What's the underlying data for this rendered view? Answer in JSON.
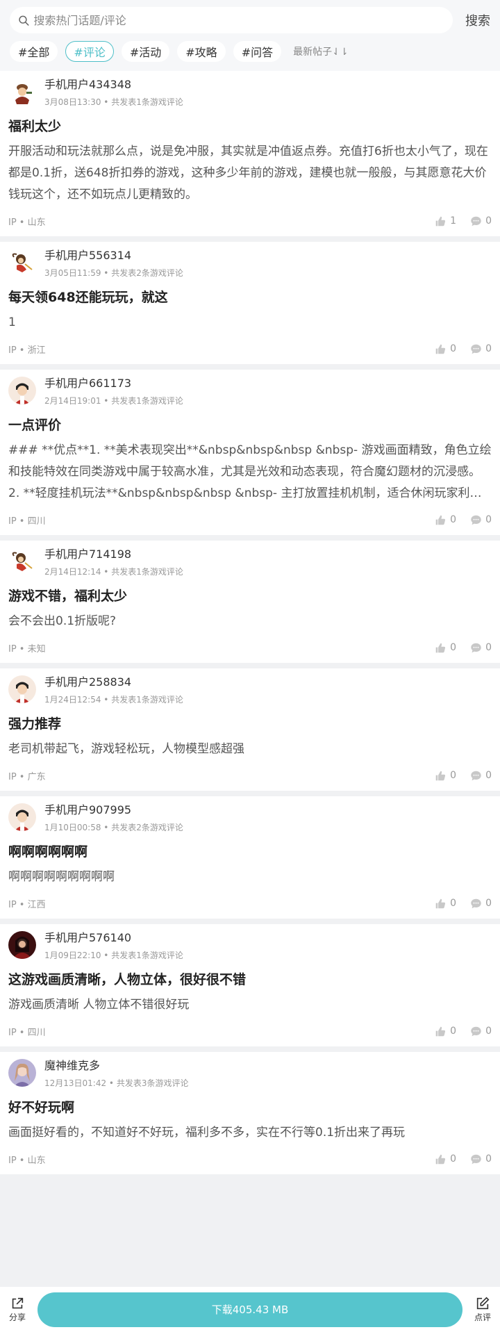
{
  "search": {
    "placeholder": "搜索热门话题/评论",
    "button": "搜索"
  },
  "tags": [
    {
      "label": "#全部",
      "active": false
    },
    {
      "label": "#评论",
      "active": true
    },
    {
      "label": "#活动",
      "active": false
    },
    {
      "label": "#攻略",
      "active": false
    },
    {
      "label": "#问答",
      "active": false
    }
  ],
  "sort_label": "最新帖子⇃⇂",
  "posts": [
    {
      "user": "手机用户434348",
      "meta": "3月08日13:30 • 共发表1条游戏评论",
      "title": "福利太少",
      "body": "开服活动和玩法就那么点，说是免冲服，其实就是冲值返点券。充值打6折也太小气了，现在都是0.1折，送648折扣券的游戏，这种多少年前的游戏，建模也就一般般，与其愿意花大价钱玩这个，还不如玩点儿更精致的。",
      "ip": "IP • 山东",
      "likes": "1",
      "comments": "0",
      "avatar": "warrior"
    },
    {
      "user": "手机用户556314",
      "meta": "3月05日11:59 • 共发表2条游戏评论",
      "title": "每天领648还能玩玩，就这",
      "body": "1",
      "ip": "IP • 浙江",
      "likes": "0",
      "comments": "0",
      "avatar": "monkey"
    },
    {
      "user": "手机用户661173",
      "meta": "2月14日19:01 • 共发表1条游戏评论",
      "title": "一点评价",
      "body": "### **优点**1. **美术表现突出**&nbsp&nbsp&nbsp &nbsp- 游戏画面精致，角色立绘和技能特效在同类游戏中属于较高水准，尤其是光效和动态表现，符合魔幻题材的沉浸感。2. **轻度挂机玩法**&nbsp&nbsp&nbsp &nbsp- 主打放置挂机机制，适合休闲玩家利用碎片时间游玩。",
      "ip": "IP • 四川",
      "likes": "0",
      "comments": "0",
      "avatar": "boy"
    },
    {
      "user": "手机用户714198",
      "meta": "2月14日12:14 • 共发表1条游戏评论",
      "title": "游戏不错，福利太少",
      "body": "会不会出0.1折版呢?",
      "ip": "IP • 未知",
      "likes": "0",
      "comments": "0",
      "avatar": "monkey"
    },
    {
      "user": "手机用户258834",
      "meta": "1月24日12:54 • 共发表1条游戏评论",
      "title": "强力推荐",
      "body": "老司机带起飞，游戏轻松玩，人物模型感超强",
      "ip": "IP • 广东",
      "likes": "0",
      "comments": "0",
      "avatar": "boy"
    },
    {
      "user": "手机用户907995",
      "meta": "1月10日00:58 • 共发表2条游戏评论",
      "title": "啊啊啊啊啊啊",
      "body": "啊啊啊啊啊啊啊啊啊",
      "ip": "IP • 江西",
      "likes": "0",
      "comments": "0",
      "avatar": "boy"
    },
    {
      "user": "手机用户576140",
      "meta": "1月09日22:10 • 共发表1条游戏评论",
      "title": "这游戏画质清晰，人物立体，很好很不错",
      "body": "游戏画质清晰 人物立体不错很好玩",
      "ip": "IP • 四川",
      "likes": "0",
      "comments": "0",
      "avatar": "dark"
    },
    {
      "user": "魔神维克多",
      "meta": "12月13日01:42 • 共发表3条游戏评论",
      "title": "好不好玩啊",
      "body": "画面挺好看的，不知道好不好玩，福利多不多，实在不行等0.1折出来了再玩",
      "ip": "IP • 山东",
      "likes": "0",
      "comments": "0",
      "avatar": "girl"
    }
  ],
  "bottom": {
    "share": "分享",
    "download": "下载405.43 MB",
    "review": "点评"
  },
  "colors": {
    "accent": "#56c5cd",
    "tag_active": "#4ebfc8"
  }
}
